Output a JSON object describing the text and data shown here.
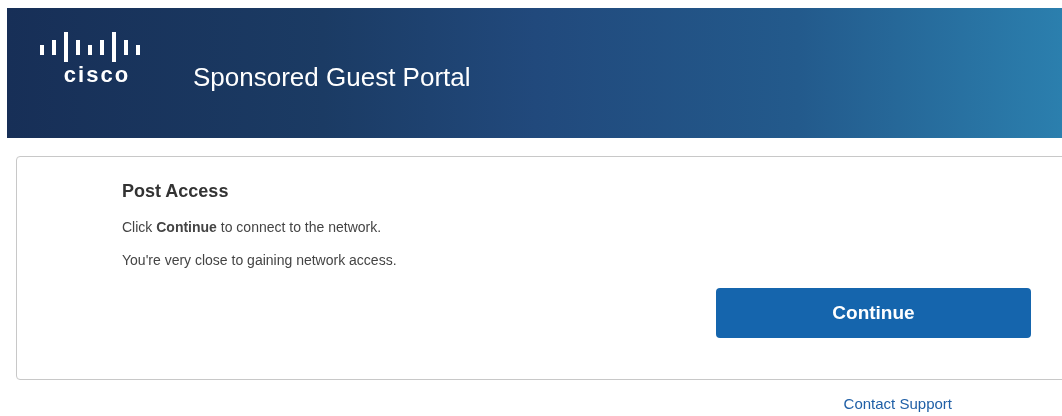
{
  "header": {
    "logo_text": "cisco",
    "title": "Sponsored Guest Portal"
  },
  "card": {
    "title": "Post Access",
    "lines": [
      "Click **Continue** to connect to the network.",
      "You're very close to gaining network access."
    ],
    "button": "Continue"
  },
  "footer_link": "Contact Support"
}
